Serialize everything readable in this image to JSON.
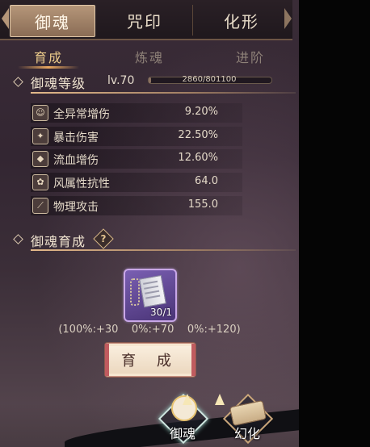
{
  "tabs": [
    "御魂",
    "咒印",
    "化形"
  ],
  "subtabs": [
    "育成",
    "炼魂",
    "进阶"
  ],
  "level_section": {
    "title": "御魂等级",
    "level": "lv.70",
    "exp_text": "2860/801100",
    "exp_progress": 0.0036
  },
  "stats": [
    {
      "name": "全异常增伤",
      "value": "9.20%",
      "icon": "mask-icon"
    },
    {
      "name": "暴击伤害",
      "value": "22.50%",
      "icon": "blade-icon"
    },
    {
      "name": "流血增伤",
      "value": "12.60%",
      "icon": "droplet-icon"
    },
    {
      "name": "风属性抗性",
      "value": "64.0",
      "icon": "wind-icon"
    },
    {
      "name": "物理攻击",
      "value": "155.0",
      "icon": "sword-icon"
    }
  ],
  "cultivate_section": {
    "title": "御魂育成",
    "help": "?",
    "item_count": "30/1",
    "rates": "(100%:+30    0%:+70    0%:+120)",
    "button": "育 成"
  },
  "nav": [
    {
      "label": "御魂",
      "icon": "spirit-character-icon"
    },
    {
      "label": "幻化",
      "icon": "scroll-icon"
    }
  ],
  "colors": {
    "accent": "#e9c98a",
    "active_tab": "#a88a6f",
    "item_frame": "#7a5fb2",
    "button_edge": "#c05b5f"
  }
}
